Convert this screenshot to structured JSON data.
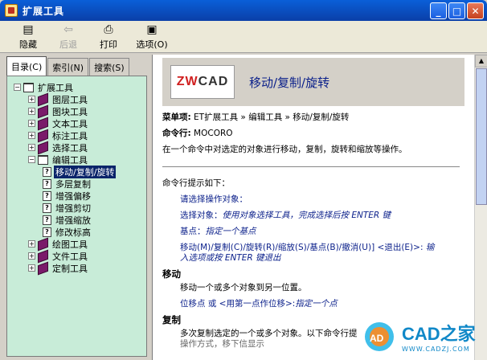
{
  "window": {
    "title": "扩展工具"
  },
  "toolbar": {
    "hide": "隐藏",
    "back": "后退",
    "print": "打印",
    "options": "选项(O)"
  },
  "tabs": [
    "目录(C)",
    "索引(N)",
    "搜索(S)"
  ],
  "tree": [
    {
      "label": "扩展工具",
      "level": 0,
      "type": "open"
    },
    {
      "label": "图层工具",
      "level": 1,
      "type": "closed"
    },
    {
      "label": "图块工具",
      "level": 1,
      "type": "closed"
    },
    {
      "label": "文本工具",
      "level": 1,
      "type": "closed"
    },
    {
      "label": "标注工具",
      "level": 1,
      "type": "closed"
    },
    {
      "label": "选择工具",
      "level": 1,
      "type": "closed"
    },
    {
      "label": "编辑工具",
      "level": 1,
      "type": "open"
    },
    {
      "label": "移动/复制/旋转",
      "level": 2,
      "type": "page",
      "selected": true
    },
    {
      "label": "多层复制",
      "level": 2,
      "type": "page"
    },
    {
      "label": "增强偏移",
      "level": 2,
      "type": "page"
    },
    {
      "label": "增强剪切",
      "level": 2,
      "type": "page"
    },
    {
      "label": "增强缩放",
      "level": 2,
      "type": "page"
    },
    {
      "label": "修改标高",
      "level": 2,
      "type": "page"
    },
    {
      "label": "绘图工具",
      "level": 1,
      "type": "closed"
    },
    {
      "label": "文件工具",
      "level": 1,
      "type": "closed"
    },
    {
      "label": "定制工具",
      "level": 1,
      "type": "closed"
    }
  ],
  "header": {
    "logo_zw": "ZW",
    "logo_cad": "CAD",
    "title": "移动/复制/旋转"
  },
  "content": {
    "menu_label": "菜单项:",
    "menu_path": "ET扩展工具 » 编辑工具 » 移动/复制/旋转",
    "cmd_label": "命令行:",
    "cmd_value": "MOCORO",
    "desc": "在一个命令中对选定的对象进行移动，复制，旋转和缩放等操作。",
    "prompt_intro": "命令行提示如下：",
    "p1": "请选择操作对象：",
    "p2a": "选择对象：",
    "p2b": "使用对象选择工具，完成选择后按 ENTER 键",
    "p3a": "基点：",
    "p3b": "指定一个基点",
    "p4a": "移动(M)/复制(C)/旋转(R)/缩放(S)/基点(B)/撤消(U)] <退出(E)>:",
    "p4b": "输",
    "p4c": "入选项或按 ENTER 键退出",
    "move_title": "移动",
    "move_desc": "移动一个或多个对象到另一位置。",
    "move_p1": "位移点 或 <用第一点作位移>:",
    "move_p2": "指定一个点",
    "copy_title": "复制",
    "copy_desc": "多次复制选定的一个或多个对象。以下命令行提",
    "copy_desc2": "操作方式，移下信显示"
  },
  "watermark": {
    "ad": "AD",
    "brand": "CAD之家",
    "url": "WWW.CADZJ.COM"
  }
}
